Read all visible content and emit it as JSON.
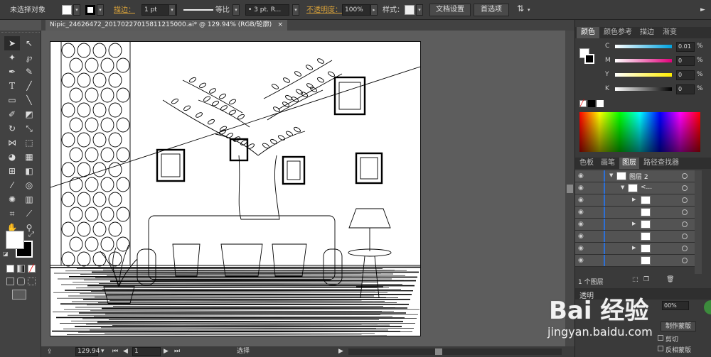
{
  "control_bar": {
    "selection": "未选择对象",
    "stroke_label": "描边：",
    "stroke_weight": "1 pt",
    "profile_label": "等比",
    "brush": "• 3 pt. R...",
    "opacity_label": "不透明度：",
    "opacity": "100%",
    "style_label": "样式：",
    "doc_setup": "文档设置",
    "preferences": "首选项",
    "arrow": "►"
  },
  "document": {
    "tab_title": "Nipic_24626472_20170227015811215000.ai* @ 129.94% (RGB/轮廓)",
    "close": "×"
  },
  "status": {
    "zoom": "129.94",
    "page": "1",
    "mode": "选择"
  },
  "color_panel": {
    "tabs": [
      "颜色",
      "颜色参考",
      "描边",
      "渐变"
    ],
    "channels": [
      {
        "name": "C",
        "value": "0.01"
      },
      {
        "name": "M",
        "value": "0"
      },
      {
        "name": "Y",
        "value": "0"
      },
      {
        "name": "K",
        "value": "0"
      }
    ],
    "percent": "%"
  },
  "layers_panel": {
    "tabs": [
      "色板",
      "画笔",
      "图层",
      "路径查找器"
    ],
    "layer_name": "图层 2",
    "sublayer_name": "<...",
    "footer": "1 个图层"
  },
  "transparency_panel": {
    "title": "透明",
    "opacity": "00%",
    "make_mask": "制作蒙版",
    "clip": "剪切",
    "invert": "反相蒙版"
  },
  "watermark": {
    "logo": "Bai 经验",
    "url": "jingyan.baidu.com"
  },
  "colors": {
    "accent": "#2d6fd5",
    "panel": "#3a3a3a"
  }
}
